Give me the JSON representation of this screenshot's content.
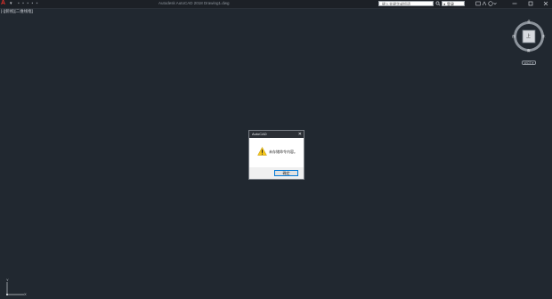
{
  "titlebar": {
    "app_logo": "A",
    "app_menu_caret": "▾",
    "window_title": "Autodesk AutoCAD 2018    Drawing1.dwg",
    "search_placeholder": "键入关键字或短语",
    "search_icon": "search-icon",
    "signin_label": "登录",
    "signin_icon": "user-icon",
    "window_controls": [
      "minimize",
      "restore",
      "close"
    ]
  },
  "viewport": {
    "controls_label": "[-][俯视][二维线框]"
  },
  "viewcube": {
    "face_label": "上",
    "compass_n": "北",
    "compass_s": "南",
    "compass_e": "东",
    "compass_w": "西",
    "wcs_label": "WCS ▾"
  },
  "ucs": {
    "x_label": "X",
    "y_label": "Y"
  },
  "dialog": {
    "title": "AutoCAD",
    "close_glyph": "✕",
    "message": "未存储命令内容。",
    "ok_label": "确定"
  },
  "colors": {
    "canvas_bg": "#212830",
    "titlebar_bg": "#1c2026",
    "dialog_accent": "#0078d7",
    "warning_yellow": "#f5c518",
    "logo_red": "#e0312b"
  }
}
